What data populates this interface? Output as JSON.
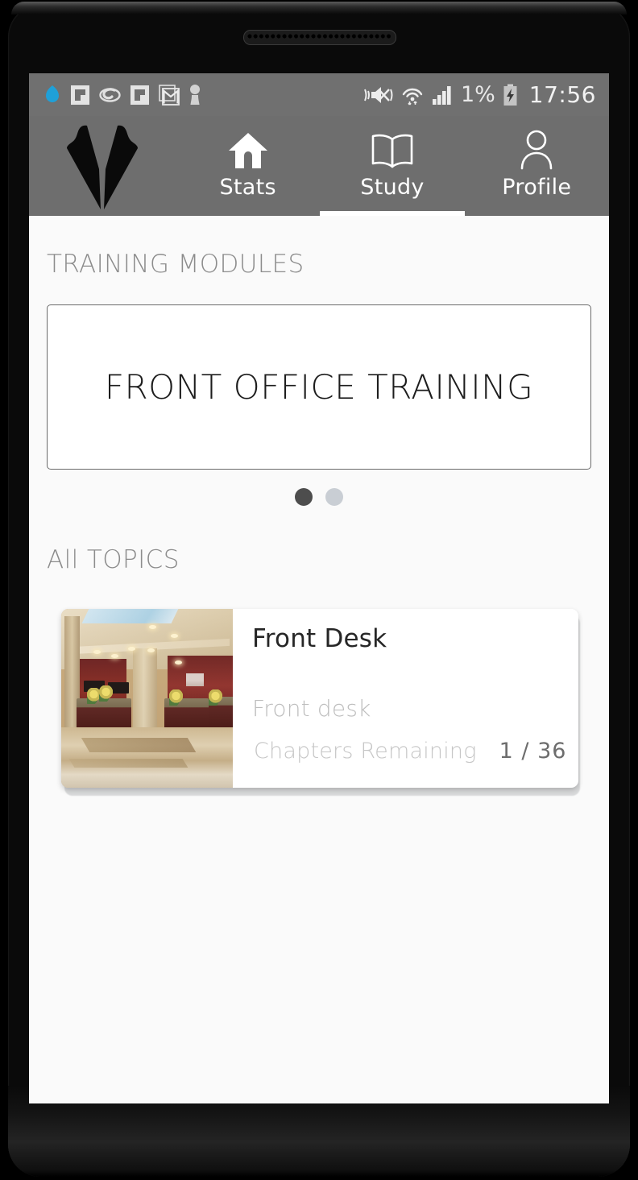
{
  "status_bar": {
    "left_icons": [
      {
        "name": "dropbox-blue-icon",
        "glyph": "droplet"
      },
      {
        "name": "flipboard-icon-1",
        "glyph": "square-flip"
      },
      {
        "name": "swirl-g-icon",
        "glyph": "swirl"
      },
      {
        "name": "flipboard-icon-2",
        "glyph": "square-flip"
      },
      {
        "name": "gmail-icon",
        "glyph": "envelope-m"
      },
      {
        "name": "keyhole-person-icon",
        "glyph": "keyhole"
      }
    ],
    "vibrate_icon": "vibrate-mute-icon",
    "wifi_icon": "wifi-icon",
    "signal_icon": "cellular-signal-icon",
    "battery_percent": "1%",
    "battery_icon": "battery-charging-icon",
    "clock": "17:56"
  },
  "navbar": {
    "logo_name": "suit-lapel-logo",
    "logo_color": "#0a0a0a",
    "background": "#6e6e6e",
    "tabs": [
      {
        "label": "Stats",
        "icon": "home-icon",
        "active": false
      },
      {
        "label": "Study",
        "icon": "book-icon",
        "active": true
      },
      {
        "label": "Profile",
        "icon": "person-icon",
        "active": false
      }
    ]
  },
  "main": {
    "training_modules": {
      "heading": "TRAINING MODULES",
      "card_title": "FRONT OFFICE TRAINING",
      "pager": {
        "count": 2,
        "active_index": 0
      }
    },
    "topics": {
      "heading": "All TOPICS",
      "items": [
        {
          "title": "Front Desk",
          "description": "Front desk",
          "meta_label": "Chapters Remaining",
          "meta_value": "1 / 36",
          "thumbnail": "hotel-lobby-reception-photo"
        }
      ]
    }
  },
  "theme": {
    "screen_background": "#fafafa",
    "status_bar_background": "#707070",
    "nav_background": "#6e6e6e",
    "accent_text": "#8c8c8c",
    "active_dot": "#4d4d4d",
    "inactive_dot": "#c9ced4"
  }
}
